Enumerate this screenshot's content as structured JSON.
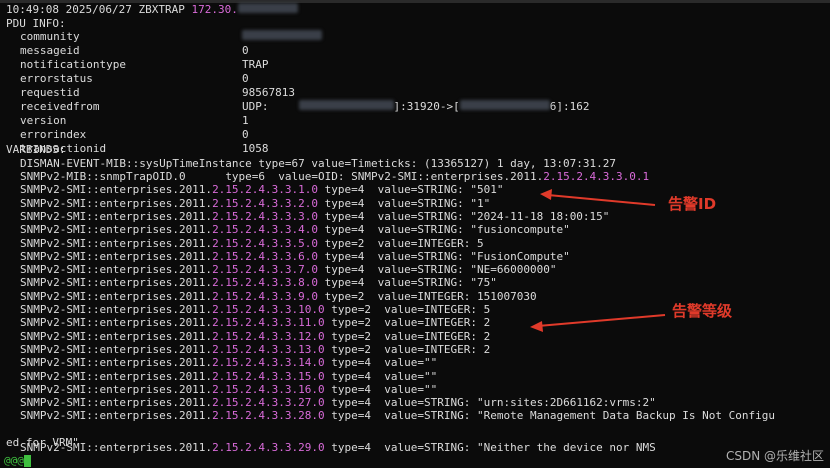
{
  "header": {
    "timestamp": "10:49:08 2025/06/27",
    "tag": "ZBXTRAP",
    "ip_prefix": "172.30."
  },
  "pdu": {
    "title": "PDU INFO:",
    "fields": [
      {
        "key": "community",
        "value": ""
      },
      {
        "key": "messageid",
        "value": "0"
      },
      {
        "key": "notificationtype",
        "value": "TRAP"
      },
      {
        "key": "errorstatus",
        "value": "0"
      },
      {
        "key": "requestid",
        "value": "98567813"
      },
      {
        "key": "receivedfrom",
        "value": "UDP:"
      },
      {
        "key": "version",
        "value": "1"
      },
      {
        "key": "errorindex",
        "value": "0"
      },
      {
        "key": "transactionid",
        "value": "1058"
      }
    ],
    "receivedfrom_port1": "]:31920->[",
    "receivedfrom_port2": "6]:162"
  },
  "varbinds_title": "VARBINDS:",
  "uptime_line": "DISMAN-EVENT-MIB::sysUpTimeInstance type=67 value=Timeticks: (13365127) 1 day, 13:07:31.27",
  "traps": [
    {
      "pre": "SNMPv2-MIB::snmpTrapOID.0",
      "mid": "      type=6  value=OID: SNMPv2-SMI::enterprises.2011.",
      "hl": "2.15.2.4.3.3.0.1",
      "post": ""
    },
    {
      "pre": "SNMPv2-SMI::enterprises.2011.",
      "hl": "2.15.2.4.3.3.1.0",
      "post": " type=4  value=STRING: \"501\""
    },
    {
      "pre": "SNMPv2-SMI::enterprises.2011.",
      "hl": "2.15.2.4.3.3.2.0",
      "post": " type=4  value=STRING: \"1\""
    },
    {
      "pre": "SNMPv2-SMI::enterprises.2011.",
      "hl": "2.15.2.4.3.3.3.0",
      "post": " type=4  value=STRING: \"2024-11-18 18:00:15\""
    },
    {
      "pre": "SNMPv2-SMI::enterprises.2011.",
      "hl": "2.15.2.4.3.3.4.0",
      "post": " type=4  value=STRING: \"fusioncompute\""
    },
    {
      "pre": "SNMPv2-SMI::enterprises.2011.",
      "hl": "2.15.2.4.3.3.5.0",
      "post": " type=2  value=INTEGER: 5"
    },
    {
      "pre": "SNMPv2-SMI::enterprises.2011.",
      "hl": "2.15.2.4.3.3.6.0",
      "post": " type=4  value=STRING: \"FusionCompute\""
    },
    {
      "pre": "SNMPv2-SMI::enterprises.2011.",
      "hl": "2.15.2.4.3.3.7.0",
      "post": " type=4  value=STRING: \"NE=66000000\""
    },
    {
      "pre": "SNMPv2-SMI::enterprises.2011.",
      "hl": "2.15.2.4.3.3.8.0",
      "post": " type=4  value=STRING: \"75\""
    },
    {
      "pre": "SNMPv2-SMI::enterprises.2011.",
      "hl": "2.15.2.4.3.3.9.0",
      "post": " type=2  value=INTEGER: 151007030"
    },
    {
      "pre": "SNMPv2-SMI::enterprises.2011.",
      "hl": "2.15.2.4.3.3.10.0",
      "post": " type=2  value=INTEGER: 5"
    },
    {
      "pre": "SNMPv2-SMI::enterprises.2011.",
      "hl": "2.15.2.4.3.3.11.0",
      "post": " type=2  value=INTEGER: 2"
    },
    {
      "pre": "SNMPv2-SMI::enterprises.2011.",
      "hl": "2.15.2.4.3.3.12.0",
      "post": " type=2  value=INTEGER: 2"
    },
    {
      "pre": "SNMPv2-SMI::enterprises.2011.",
      "hl": "2.15.2.4.3.3.13.0",
      "post": " type=2  value=INTEGER: 2"
    },
    {
      "pre": "SNMPv2-SMI::enterprises.2011.",
      "hl": "2.15.2.4.3.3.14.0",
      "post": " type=4  value=\"\""
    },
    {
      "pre": "SNMPv2-SMI::enterprises.2011.",
      "hl": "2.15.2.4.3.3.15.0",
      "post": " type=4  value=\"\""
    },
    {
      "pre": "SNMPv2-SMI::enterprises.2011.",
      "hl": "2.15.2.4.3.3.16.0",
      "post": " type=4  value=\"\""
    },
    {
      "pre": "SNMPv2-SMI::enterprises.2011.",
      "hl": "2.15.2.4.3.3.27.0",
      "post": " type=4  value=STRING: \"urn:sites:2D661162:vrms:2\""
    },
    {
      "pre": "SNMPv2-SMI::enterprises.2011.",
      "hl": "2.15.2.4.3.3.28.0",
      "post": " type=4  value=STRING: \"Remote Management Data Backup Is Not Configu"
    }
  ],
  "wrap_line": "ed for VRM\"",
  "last_line": {
    "pre": "SNMPv2-SMI::enterprises.2011.",
    "hl": "2.15.2.4.3.3.29.0",
    "post": " type=4  value=STRING: \"Neither the device nor NMS"
  },
  "prompt": "@@@",
  "annotations": {
    "alarm_id": "告警ID",
    "alarm_level": "告警等级",
    "color": "#e03a2a"
  },
  "watermark": "CSDN @乐维社区"
}
